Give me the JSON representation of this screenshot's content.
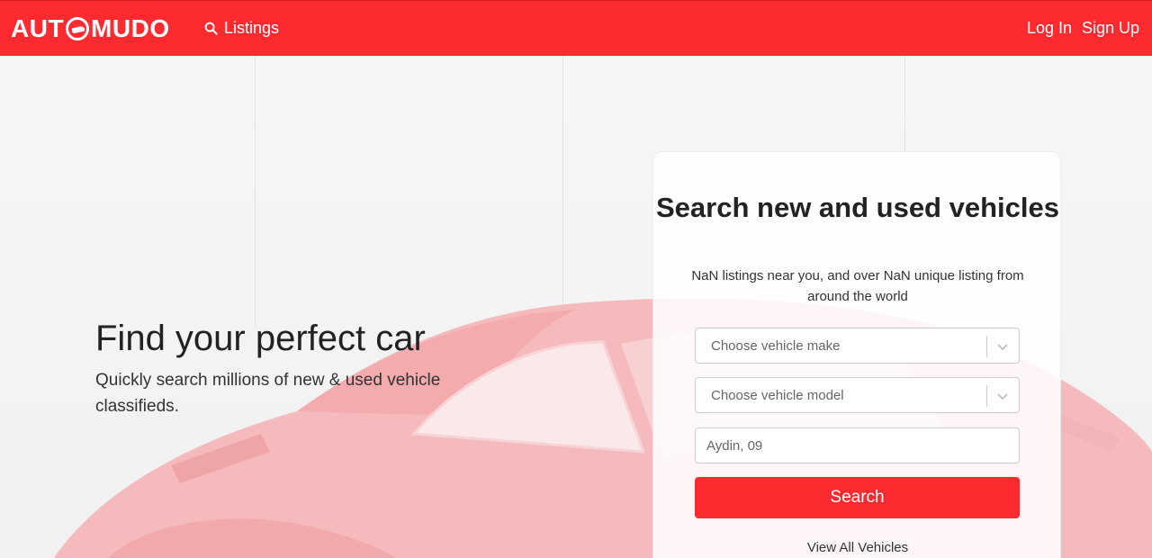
{
  "navbar": {
    "logo_text_left": "AUT",
    "logo_text_right": "MUDO",
    "listings_label": "Listings",
    "login_label": "Log In",
    "signup_label": "Sign Up",
    "brand_color": "#fd2a2f"
  },
  "hero": {
    "title": "Find your perfect car",
    "subtitle": "Quickly search millions of new & used vehicle classifieds."
  },
  "search_card": {
    "title": "Search new and used vehicles",
    "description": "NaN listings near you, and over NaN unique listing from around the world",
    "make_placeholder": "Choose vehicle make",
    "model_placeholder": "Choose vehicle model",
    "location_placeholder": "Aydin, 09",
    "search_label": "Search",
    "view_all_label": "View All Vehicles"
  },
  "icons": {
    "search": "search-icon",
    "chevron": "chevron-down-icon",
    "logo": "kangaroo-logo-icon"
  }
}
